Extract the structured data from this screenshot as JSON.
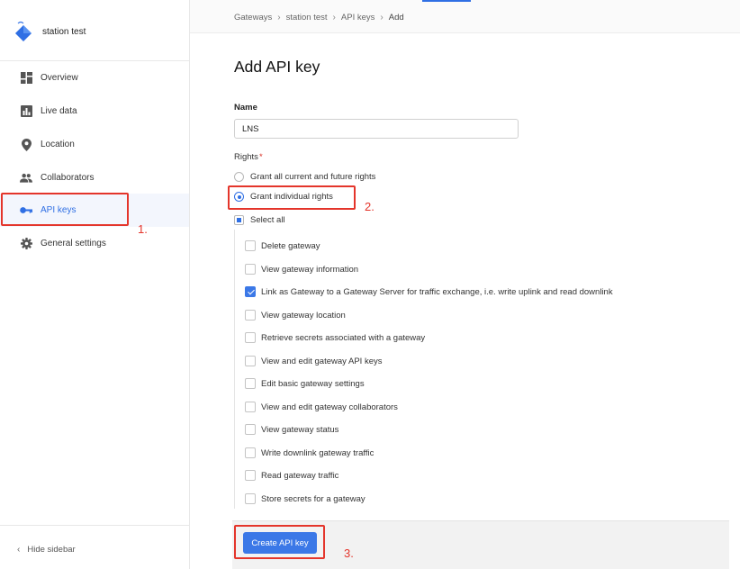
{
  "colors": {
    "accent": "#2f6fe4",
    "annotation": "#e4352b"
  },
  "sidebar": {
    "brand_name": "station test",
    "brand_icon": "gateway-diamond-icon",
    "items": [
      {
        "label": "Overview",
        "icon": "dashboard-icon",
        "active": false
      },
      {
        "label": "Live data",
        "icon": "bar-chart-icon",
        "active": false
      },
      {
        "label": "Location",
        "icon": "location-pin-icon",
        "active": false
      },
      {
        "label": "Collaborators",
        "icon": "people-icon",
        "active": false
      },
      {
        "label": "API keys",
        "icon": "key-icon",
        "active": true
      },
      {
        "label": "General settings",
        "icon": "gear-icon",
        "active": false
      }
    ],
    "hide_label": "Hide sidebar"
  },
  "breadcrumb": [
    "Gateways",
    "station test",
    "API keys",
    "Add"
  ],
  "main": {
    "title": "Add API key",
    "name_label": "Name",
    "name_value": "LNS",
    "rights_label": "Rights",
    "rights_required_mark": "*",
    "radio_all": "Grant all current and future rights",
    "radio_individual": "Grant individual rights",
    "select_all": "Select all",
    "rights": [
      {
        "label": "Delete gateway",
        "checked": false
      },
      {
        "label": "View gateway information",
        "checked": false
      },
      {
        "label": "Link as Gateway to a Gateway Server for traffic exchange, i.e. write uplink and read downlink",
        "checked": true
      },
      {
        "label": "View gateway location",
        "checked": false
      },
      {
        "label": "Retrieve secrets associated with a gateway",
        "checked": false
      },
      {
        "label": "View and edit gateway API keys",
        "checked": false
      },
      {
        "label": "Edit basic gateway settings",
        "checked": false
      },
      {
        "label": "View and edit gateway collaborators",
        "checked": false
      },
      {
        "label": "View gateway status",
        "checked": false
      },
      {
        "label": "Write downlink gateway traffic",
        "checked": false
      },
      {
        "label": "Read gateway traffic",
        "checked": false
      },
      {
        "label": "Store secrets for a gateway",
        "checked": false
      }
    ],
    "create_button": "Create API key"
  },
  "annotations": [
    "1.",
    "2.",
    "3."
  ]
}
